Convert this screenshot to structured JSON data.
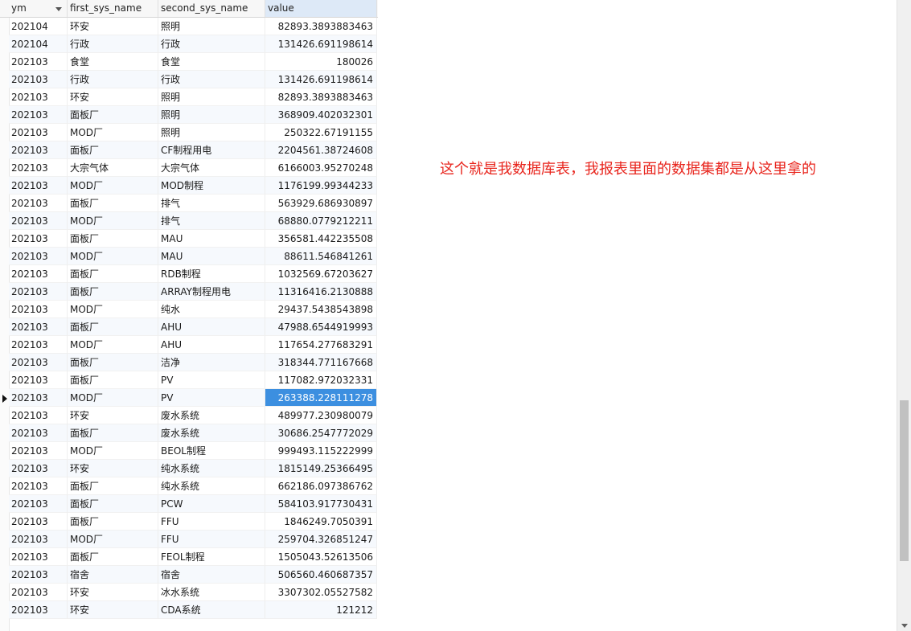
{
  "columns": [
    {
      "key": "ym",
      "label": "ym"
    },
    {
      "key": "first",
      "label": "first_sys_name"
    },
    {
      "key": "second",
      "label": "second_sys_name"
    },
    {
      "key": "value",
      "label": "value"
    }
  ],
  "rows": [
    {
      "ym": "202104",
      "first": "环安",
      "second": "照明",
      "value": "82893.3893883463"
    },
    {
      "ym": "202104",
      "first": "行政",
      "second": "行政",
      "value": "131426.691198614"
    },
    {
      "ym": "202103",
      "first": "食堂",
      "second": "食堂",
      "value": "180026"
    },
    {
      "ym": "202103",
      "first": "行政",
      "second": "行政",
      "value": "131426.691198614"
    },
    {
      "ym": "202103",
      "first": "环安",
      "second": "照明",
      "value": "82893.3893883463"
    },
    {
      "ym": "202103",
      "first": "面板厂",
      "second": "照明",
      "value": "368909.402032301"
    },
    {
      "ym": "202103",
      "first": "MOD厂",
      "second": "照明",
      "value": "250322.67191155"
    },
    {
      "ym": "202103",
      "first": "面板厂",
      "second": "CF制程用电",
      "value": "2204561.38724608"
    },
    {
      "ym": "202103",
      "first": "大宗气体",
      "second": "大宗气体",
      "value": "6166003.95270248"
    },
    {
      "ym": "202103",
      "first": "MOD厂",
      "second": "MOD制程",
      "value": "1176199.99344233"
    },
    {
      "ym": "202103",
      "first": "面板厂",
      "second": "排气",
      "value": "563929.686930897"
    },
    {
      "ym": "202103",
      "first": "MOD厂",
      "second": "排气",
      "value": "68880.0779212211"
    },
    {
      "ym": "202103",
      "first": "面板厂",
      "second": "MAU",
      "value": "356581.442235508"
    },
    {
      "ym": "202103",
      "first": "MOD厂",
      "second": "MAU",
      "value": "88611.546841261"
    },
    {
      "ym": "202103",
      "first": "面板厂",
      "second": "RDB制程",
      "value": "1032569.67203627"
    },
    {
      "ym": "202103",
      "first": "面板厂",
      "second": "ARRAY制程用电",
      "value": "11316416.2130888"
    },
    {
      "ym": "202103",
      "first": "MOD厂",
      "second": "纯水",
      "value": "29437.5438543898"
    },
    {
      "ym": "202103",
      "first": "面板厂",
      "second": "AHU",
      "value": "47988.6544919993"
    },
    {
      "ym": "202103",
      "first": "MOD厂",
      "second": "AHU",
      "value": "117654.277683291"
    },
    {
      "ym": "202103",
      "first": "面板厂",
      "second": "洁净",
      "value": "318344.771167668"
    },
    {
      "ym": "202103",
      "first": "面板厂",
      "second": "PV",
      "value": "117082.972032331"
    },
    {
      "ym": "202103",
      "first": "MOD厂",
      "second": "PV",
      "value": "263388.228111278"
    },
    {
      "ym": "202103",
      "first": "环安",
      "second": "废水系统",
      "value": "489977.230980079"
    },
    {
      "ym": "202103",
      "first": "面板厂",
      "second": "废水系统",
      "value": "30686.2547772029"
    },
    {
      "ym": "202103",
      "first": "MOD厂",
      "second": "BEOL制程",
      "value": "999493.115222999"
    },
    {
      "ym": "202103",
      "first": "环安",
      "second": "纯水系统",
      "value": "1815149.25366495"
    },
    {
      "ym": "202103",
      "first": "面板厂",
      "second": "纯水系统",
      "value": "662186.097386762"
    },
    {
      "ym": "202103",
      "first": "面板厂",
      "second": "PCW",
      "value": "584103.917730431"
    },
    {
      "ym": "202103",
      "first": "面板厂",
      "second": "FFU",
      "value": "1846249.7050391"
    },
    {
      "ym": "202103",
      "first": "MOD厂",
      "second": "FFU",
      "value": "259704.326851247"
    },
    {
      "ym": "202103",
      "first": "面板厂",
      "second": "FEOL制程",
      "value": "1505043.52613506"
    },
    {
      "ym": "202103",
      "first": "宿舍",
      "second": "宿舍",
      "value": "506560.460687357"
    },
    {
      "ym": "202103",
      "first": "环安",
      "second": "冰水系统",
      "value": "3307302.05527582"
    },
    {
      "ym": "202103",
      "first": "环安",
      "second": "CDA系统",
      "value": "121212"
    }
  ],
  "selected_row": 21,
  "annotation": "这个就是我数据库表，我报表里面的数据集都是从这里拿的",
  "colors": {
    "annotation": "#e8241c",
    "selection": "#3c8fe0",
    "header_highlight": "#dde9f7"
  },
  "icons": {
    "sort": "sort-desc-icon",
    "row_pointer": "row-pointer-icon"
  }
}
